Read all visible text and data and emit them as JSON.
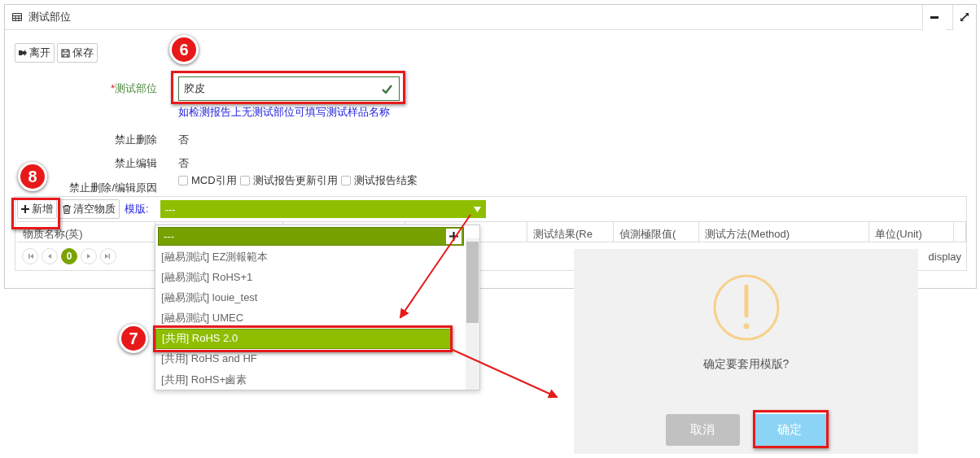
{
  "panel": {
    "title": "测试部位"
  },
  "toolbar": [
    {
      "label": "离开",
      "kind": "leave"
    },
    {
      "label": "保存",
      "kind": "save"
    }
  ],
  "form": {
    "required_mark": "*",
    "label": "测试部位",
    "value": "胶皮",
    "valid": true,
    "hint": "如检测报告上无测试部位可填写测试样品名称",
    "rows": [
      {
        "label": "禁止删除",
        "value": "否"
      },
      {
        "label": "禁止编辑",
        "value": "否"
      }
    ],
    "reasons": {
      "label": "禁止删除/编辑原因",
      "options": [
        {
          "label": "MCD引用",
          "checked": false
        },
        {
          "label": "测试报告更新引用",
          "checked": false
        },
        {
          "label": "测试报告结案",
          "checked": false
        }
      ]
    }
  },
  "grid": {
    "buttons": [
      {
        "label": "新增",
        "kind": "add"
      },
      {
        "label": "清空物质",
        "kind": "clear"
      }
    ],
    "template_label": "模版:",
    "template_value": "---",
    "columns": [
      {
        "label": "物质名称(英)"
      },
      {
        "label": "测试结果(Re"
      },
      {
        "label": "偵測極限值("
      },
      {
        "label": "测试方法(Method)"
      },
      {
        "label": "单位(Unit)"
      }
    ],
    "pager": {
      "page": "0"
    },
    "footer_text": "display"
  },
  "dropdown": {
    "search_value": "---",
    "options": [
      {
        "label": "[融易測試] EZ測報範本",
        "selected": false
      },
      {
        "label": "[融易測試] RoHS+1",
        "selected": false
      },
      {
        "label": "[融易測試] louie_test",
        "selected": false
      },
      {
        "label": "[融易測試] UMEC",
        "selected": false
      },
      {
        "label": "[共用] RoHS 2.0",
        "selected": true
      },
      {
        "label": "[共用] RoHS and HF",
        "selected": false
      },
      {
        "label": "[共用] RoHS+鹵素",
        "selected": false
      }
    ]
  },
  "dialog": {
    "message": "确定要套用模版?",
    "buttons": [
      {
        "label": "取消",
        "kind": "cancel"
      },
      {
        "label": "确定",
        "kind": "confirm"
      }
    ]
  },
  "annotations": [
    {
      "number": "6"
    },
    {
      "number": "8"
    },
    {
      "number": "7"
    }
  ]
}
